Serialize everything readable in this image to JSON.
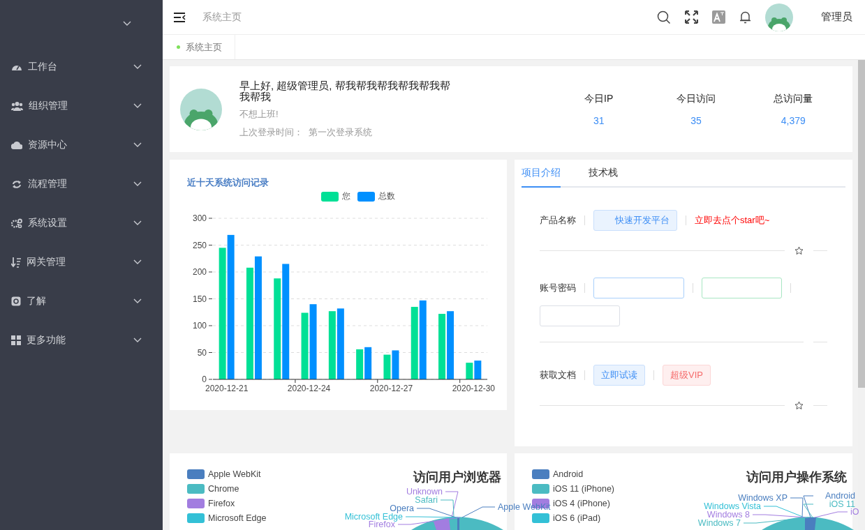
{
  "sidebar": {
    "items": [
      {
        "label": "工作台",
        "kind": "gauge"
      },
      {
        "label": "组织管理",
        "kind": "users"
      },
      {
        "label": "资源中心",
        "kind": "cloud"
      },
      {
        "label": "流程管理",
        "kind": "cycle"
      },
      {
        "label": "系统设置",
        "kind": "gears"
      },
      {
        "label": "网关管理",
        "kind": "sort"
      },
      {
        "label": "了解",
        "kind": "info"
      },
      {
        "label": "更多功能",
        "kind": "grid"
      }
    ]
  },
  "header": {
    "breadcrumb": "系统主页",
    "user": "管理员"
  },
  "tabs": [
    {
      "label": "系统主页",
      "selected": true
    }
  ],
  "welcome": {
    "greeting": "早上好, 超级管理员, 帮我帮我帮我帮我帮我帮我帮我",
    "motto": "不想上班!",
    "last_login_label": "上次登录时间：",
    "last_login_value": "第一次登录系统"
  },
  "stats": [
    {
      "label": "今日IP",
      "value": "31"
    },
    {
      "label": "今日访问",
      "value": "35"
    },
    {
      "label": "总访问量",
      "value": "4,379"
    }
  ],
  "visits": {
    "title": "近十天系统访问记录",
    "chart_data": {
      "type": "bar",
      "grid": true,
      "categories": [
        "2020-12-21",
        null,
        null,
        "2020-12-24",
        null,
        null,
        "2020-12-27",
        null,
        null,
        "2020-12-30"
      ],
      "series": [
        {
          "name": "您",
          "color": "#00e096",
          "values": [
            245,
            208,
            188,
            124,
            127,
            56,
            46,
            135,
            122,
            31
          ]
        },
        {
          "name": "总数",
          "color": "#0090ff",
          "values": [
            269,
            229,
            215,
            140,
            132,
            60,
            54,
            147,
            127,
            35
          ]
        }
      ],
      "ylim": [
        0,
        300
      ],
      "yticks": [
        0,
        50,
        100,
        150,
        200,
        250,
        300
      ]
    }
  },
  "project": {
    "tabs": [
      {
        "label": "项目介绍",
        "selected": true
      },
      {
        "label": "技术栈",
        "selected": false
      }
    ],
    "rows": [
      {
        "label": "产品名称",
        "items": [
          {
            "kind": "tag",
            "color": "#3d8ef5",
            "text": "快速开发平台"
          },
          {
            "kind": "link",
            "color": "#ff0000",
            "text": "立即去点个star吧~"
          }
        ]
      },
      {
        "label": "账号密码",
        "items": [
          {
            "kind": "input",
            "color": "#a9d0fb"
          },
          {
            "kind": "input",
            "color": "#a8e6c3"
          },
          {
            "kind": "input",
            "color": "#dcdfe6"
          }
        ]
      },
      {
        "label": "获取文档",
        "items": [
          {
            "kind": "tag",
            "color": "#3d8ef5",
            "text": "立即试读"
          },
          {
            "kind": "tag",
            "color": "#f56c6c",
            "text": "超级VIP"
          }
        ]
      }
    ]
  },
  "browsers": {
    "title": "访问用户浏览器",
    "legend": [
      {
        "name": "Apple WebKit",
        "color": "#4a7ebf"
      },
      {
        "name": "Chrome",
        "color": "#4bbbc2"
      },
      {
        "name": "Firefox",
        "color": "#a27de0"
      },
      {
        "name": "Microsoft Edge",
        "color": "#33c0d6"
      }
    ],
    "slice_labels": [
      {
        "text": "Unknown",
        "color": "#a27de0"
      },
      {
        "text": "Safari",
        "color": "#4bbbc2"
      },
      {
        "text": "Opera",
        "color": "#4a7ebf"
      },
      {
        "text": "Microsoft Edge",
        "color": "#33c0d6"
      },
      {
        "text": "Firefox",
        "color": "#a27de0"
      },
      {
        "text": "Apple WebKit",
        "color": "#4a7ebf"
      }
    ]
  },
  "systems": {
    "title": "访问用户操作系统",
    "legend": [
      {
        "name": "Android",
        "color": "#4a7ebf"
      },
      {
        "name": "iOS 11 (iPhone)",
        "color": "#4bbbc2"
      },
      {
        "name": "iOS 4 (iPhone)",
        "color": "#a27de0"
      },
      {
        "name": "iOS 6 (iPad)",
        "color": "#33c0d6"
      }
    ],
    "slice_labels": [
      {
        "text": "Windows XP",
        "color": "#4a7ebf"
      },
      {
        "text": "Windows Vista",
        "color": "#33c0d6"
      },
      {
        "text": "Windows 8",
        "color": "#a27de0"
      },
      {
        "text": "Windows 7",
        "color": "#4bbbc2"
      },
      {
        "text": "Android",
        "color": "#4a7ebf"
      },
      {
        "text": "iOS 11",
        "color": "#4bbbc2"
      },
      {
        "text": "iO",
        "color": "#a27de0"
      }
    ]
  }
}
